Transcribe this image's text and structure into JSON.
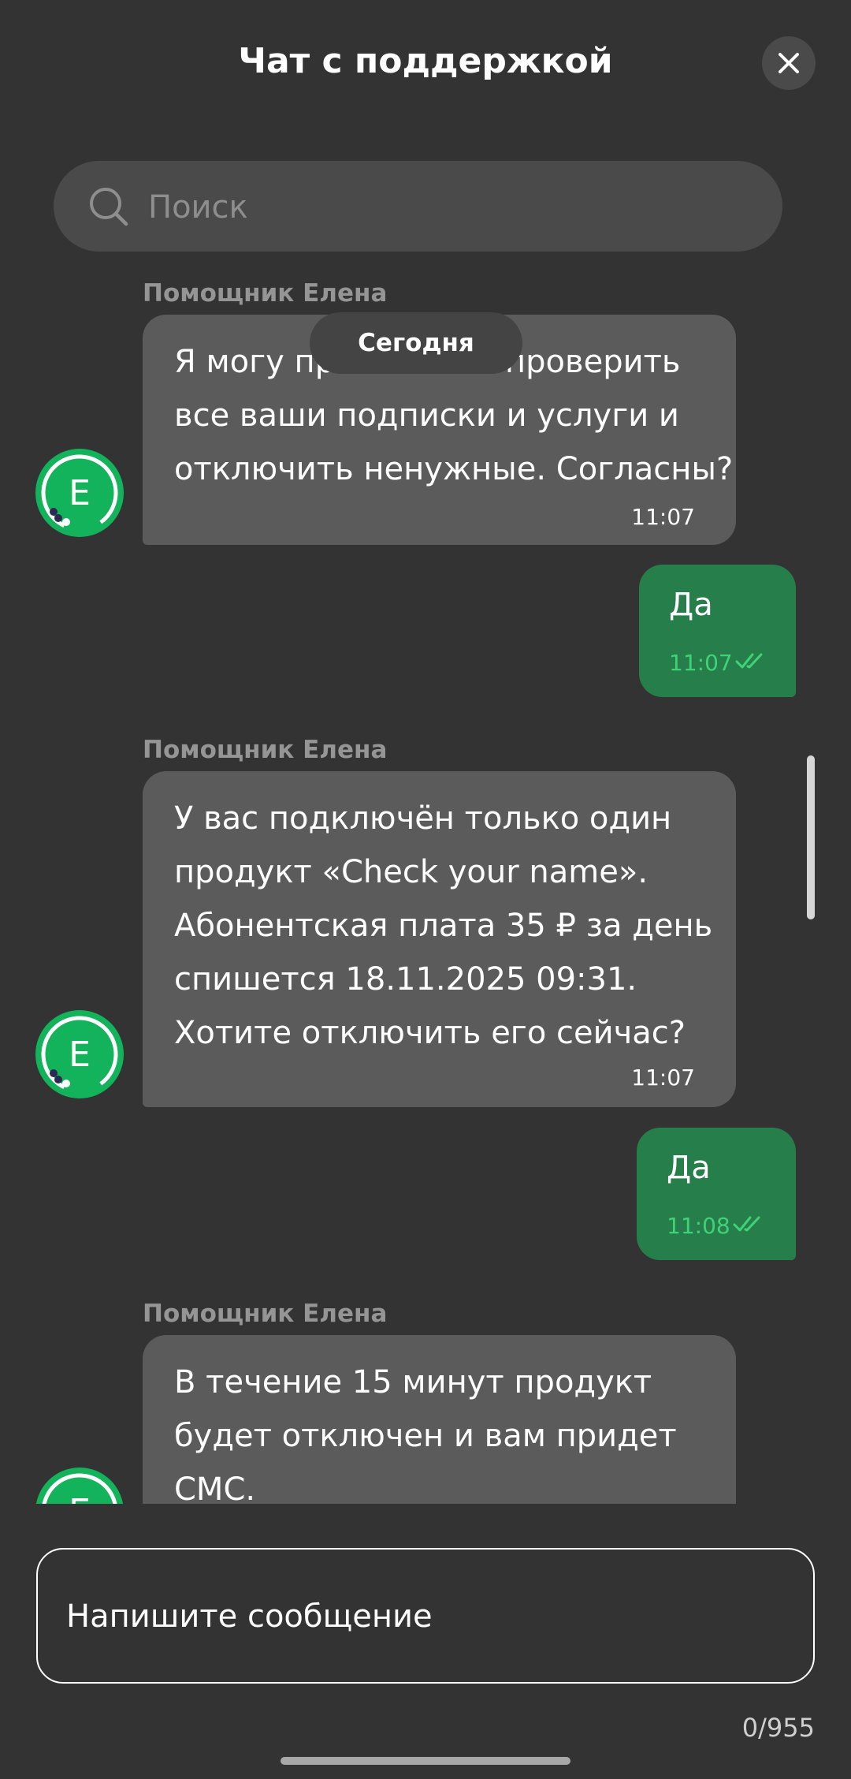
{
  "header": {
    "title": "Чат с поддержкой",
    "close_icon": "close-icon"
  },
  "search": {
    "placeholder": "Поиск",
    "icon": "search-icon"
  },
  "date_chip": "Сегодня",
  "messages": [
    {
      "type": "incoming",
      "sender": "Помощник Елена",
      "text": "Я могу проверить все ваши подписки и услуги и отключить ненужные. Согласны?",
      "visible_lines": [
        "Я могу пр",
        "проверить",
        "все ваши подписки и услуги и",
        "отключить ненужные. Согласны?"
      ],
      "time": "11:07",
      "avatar_letter": "Е"
    },
    {
      "type": "outgoing",
      "text": "Да",
      "time": "11:07",
      "status": "read"
    },
    {
      "type": "incoming",
      "sender": "Помощник Елена",
      "text": "У вас подключён только один продукт «Check your name». Абонентская плата 35 ₽ за день спишется 18.11.2025 09:31. Хотите отключить его сейчас?",
      "visible_lines": [
        "У вас подключён только один",
        "продукт «Check your name».",
        "Абонентская плата 35 ₽ за день",
        "спишется 18.11.2025 09:31.",
        "Хотите отключить его сейчас?"
      ],
      "time": "11:07",
      "avatar_letter": "Е"
    },
    {
      "type": "outgoing",
      "text": "Да",
      "time": "11:08",
      "status": "read"
    },
    {
      "type": "incoming",
      "sender": "Помощник Елена",
      "text": "В течение 15 минут продукт будет отключен и вам придет СМС.",
      "visible_lines": [
        "В течение 15 минут продукт",
        "будет отключен и вам придет",
        "СМС."
      ],
      "avatar_letter": "Е"
    }
  ],
  "composer": {
    "placeholder": "Напишите сообщение",
    "counter": "0/955"
  },
  "colors": {
    "background": "#333333",
    "incoming_bubble": "#5b5b5b",
    "outgoing_bubble": "#267f4a",
    "accent_green": "#3fd278",
    "avatar_green": "#12b35a"
  }
}
